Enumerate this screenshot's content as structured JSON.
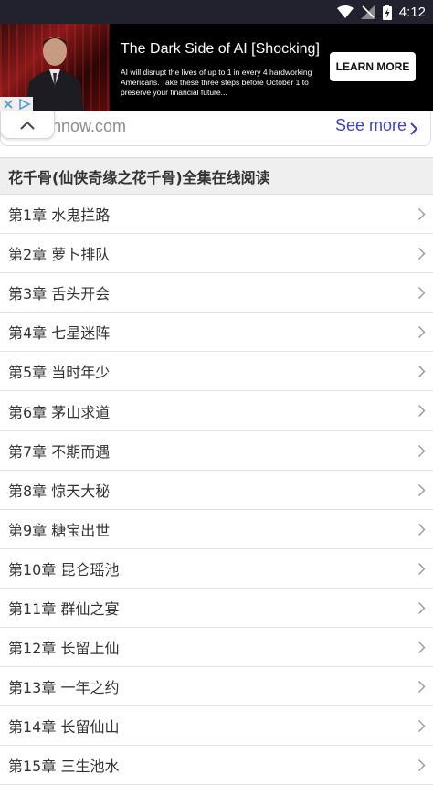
{
  "status_bar": {
    "time": "4:12"
  },
  "ad": {
    "title": "The Dark Side of AI [Shocking]",
    "body": "AI will disrupt the lives of up to 1 in every 4 hardworking Americans. Take these three steps before October 1 to preserve your financial future...",
    "cta_label": "LEARN MORE"
  },
  "url_bar": {
    "url_text": "nnow.com",
    "see_more_label": "See more"
  },
  "section": {
    "title": "花千骨(仙侠奇缘之花千骨)全集在线阅读"
  },
  "chapters": [
    {
      "label": "第1章 水鬼拦路"
    },
    {
      "label": "第2章 萝卜排队"
    },
    {
      "label": "第3章 舌头开会"
    },
    {
      "label": "第4章 七星迷阵"
    },
    {
      "label": "第5章 当时年少"
    },
    {
      "label": "第6章 茅山求道"
    },
    {
      "label": "第7章 不期而遇"
    },
    {
      "label": "第8章 惊天大秘"
    },
    {
      "label": "第9章 糖宝出世"
    },
    {
      "label": "第10章 昆仑瑶池"
    },
    {
      "label": "第11章 群仙之宴"
    },
    {
      "label": "第12章 长留上仙"
    },
    {
      "label": "第13章 一年之约"
    },
    {
      "label": "第14章 长留仙山"
    },
    {
      "label": "第15章 三生池水"
    }
  ]
}
